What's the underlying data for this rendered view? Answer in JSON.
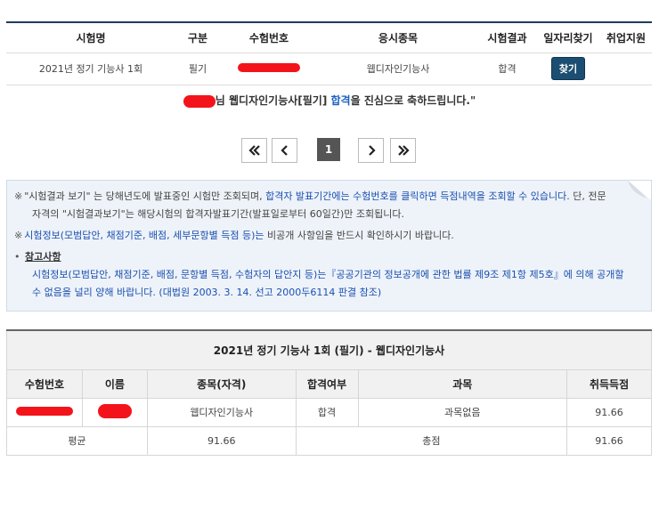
{
  "top_table": {
    "headers": [
      "시험명",
      "구분",
      "수험번호",
      "응시종목",
      "시험결과",
      "일자리찾기",
      "취업지원"
    ],
    "row": {
      "exam_name": "2021년 정기 기능사 1회",
      "type": "필기",
      "exam_number": "",
      "subject": "웹디자인기능사",
      "result": "합격",
      "find_button": "찾기"
    }
  },
  "congrats": {
    "prefix": "님 웹디자인기능사[필기] ",
    "pass": "합격",
    "suffix": "을 진심으로 축하드립니다.\""
  },
  "pagination": {
    "first": "«",
    "prev": "‹",
    "current": "1",
    "next": "›",
    "last": "»"
  },
  "notice": {
    "mark": "※",
    "bullet": "•",
    "line1_a": "\"시험결과 보기\" 는 당해년도에 발표중인 시험만 조회되며, ",
    "line1_b": "합격자 발표기간에는 수험번호를 클릭하면 득점내역을 조회할 수 있습니다",
    "line1_c": ". 단, 전문",
    "line1_d": "자격의 \"시험결과보기\"는 해당시험의 합격자발표기간(발표일로부터 60일간)만 조회됩니다.",
    "line2_a": "시험정보(모범답안, 채점기준, 배점, 세부문항별 득점 등)는",
    "line2_b": " 비공개 사항임을 반드시 확인하시기 바랍니다.",
    "ref_title": "참고사항",
    "ref_line1": "시험정보(모범답안, 채점기준, 배점, 문항별 득점, 수험자의 답안지 등)는『공공기관의 정보공개에 관한 법률 제9조 제1항 제5호』에 의해 공개할",
    "ref_line2": "수 없음을 널리 양해 바랍니다. (대법원 2003. 3. 14. 선고 2000두6114 판결 참조)"
  },
  "detail": {
    "caption": "2021년 정기 기능사 1회 (필기) - 웹디자인기능사",
    "headers": [
      "수험번호",
      "이름",
      "종목(자격)",
      "합격여부",
      "과목",
      "취득득점"
    ],
    "row": {
      "exam_number": "",
      "name": "",
      "subject": "웹디자인기능사",
      "result": "합격",
      "course": "과목없음",
      "score": "91.66"
    },
    "summary": {
      "avg_label": "평균",
      "avg_value": "91.66",
      "total_label": "총점",
      "total_value": "91.66"
    }
  },
  "colors": {
    "redaction": "#f3141b",
    "find_button": "#1c4e72",
    "link_blue": "#1a4fb0",
    "notice_bg": "#eef3f9"
  }
}
